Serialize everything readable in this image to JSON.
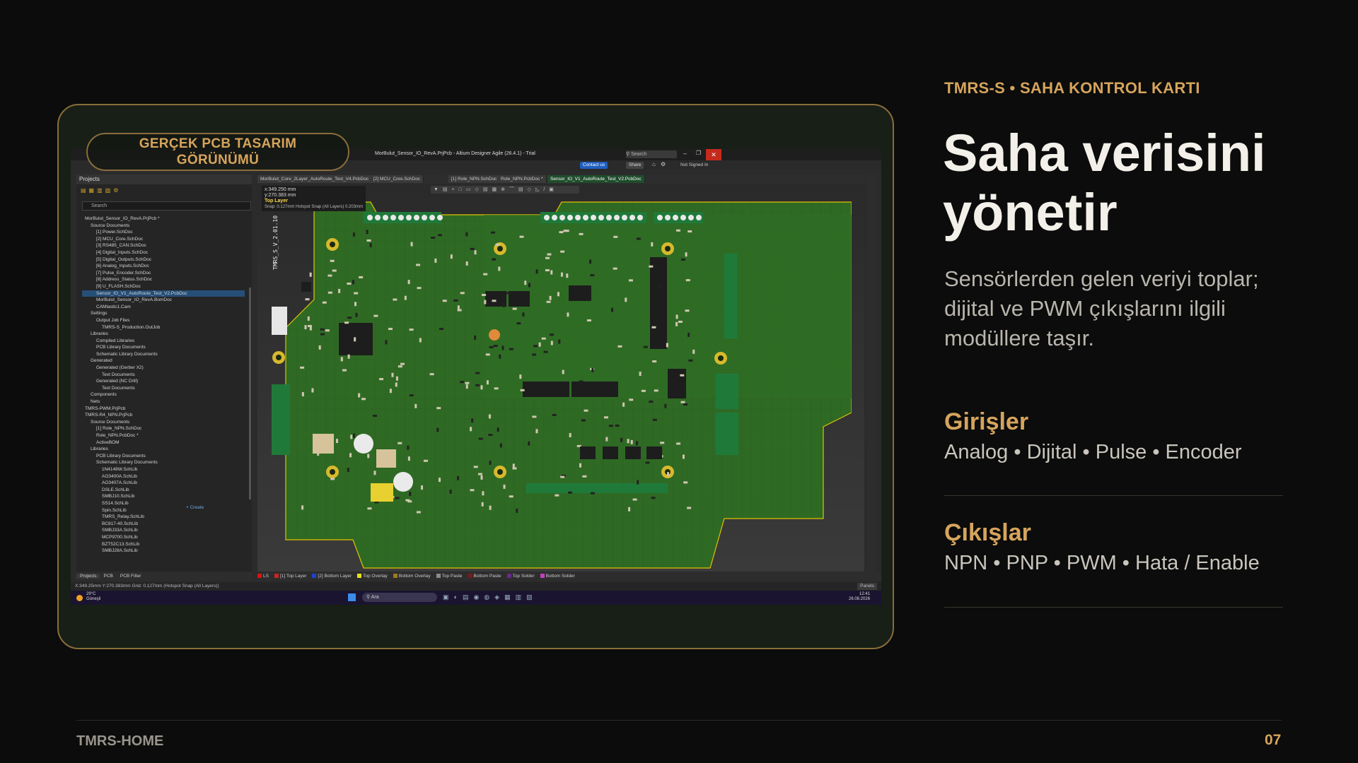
{
  "slide": {
    "eyebrow": "TMRS-S • SAHA KONTROL KARTI",
    "title_line1": "Saha verisini",
    "title_line2": "yönetir",
    "description": "Sensörlerden gelen veriyi toplar; dijital ve PWM çıkışlarını ilgili modüllere taşır.",
    "inputs": {
      "heading": "Girişler",
      "body": "Analog • Dijital • Pulse • Encoder"
    },
    "outputs": {
      "heading": "Çıkışlar",
      "body": "NPN • PNP • PWM • Hata / Enable"
    },
    "footer_left": "TMRS-HOME",
    "page_number": "07",
    "badge": "GERÇEK PCB TASARIM GÖRÜNÜMÜ"
  },
  "app": {
    "window_title": "MorBulut_Sensor_IO_RevA.PrjPcb - Altium Designer Agile (26.4.1) - Trial",
    "search_label": "Search",
    "contact_button": "Contact us",
    "share_button": "Share",
    "signin": "Not Signed In",
    "panel_title": "Projects",
    "panel_search": "Search",
    "tree": [
      "MorBulut_Sensor_IO_RevA.PrjPcb *",
      "Source Documents",
      "[1] Power.SchDoc",
      "[2] MCU_Core.SchDoc",
      "[3] RS485_CAN.SchDoc",
      "[4] Digital_Inputs.SchDoc",
      "[5] Digital_Outputs.SchDoc",
      "[6] Analog_Inputs.SchDoc",
      "[7] Pulse_Encoder.SchDoc",
      "[8] Address_Status.SchDoc",
      "[9] U_FLASH.SchDoc",
      "Sensor_IO_V1_AutoRoute_Test_V2.PcbDoc",
      "MorBulut_Sensor_IO_RevA.BomDoc",
      "CAMtastic1.Cam",
      "Settings",
      "Output Job Files",
      "TMRS-S_Production.OutJob",
      "Libraries",
      "Compiled Libraries",
      "PCB Library Documents",
      "Schematic Library Documents",
      "Generated",
      "Generated (Gerber X2)",
      "Text Documents",
      "Generated (NC Drill)",
      "Text Documents",
      "Components",
      "Nets",
      "TMRS-PWM.PrjPcb",
      "TMRS-R4_NPN.PrjPcb",
      "Source Documents",
      "[1] Role_NPN.SchDoc",
      "Role_NPN.PcbDoc *",
      "ActiveBOM",
      "Libraries",
      "PCB Library Documents",
      "Schematic Library Documents",
      "1N4148W.SchLib",
      "AO3400A.SchLib",
      "AO3407A.SchLib",
      "DSLE.SchLib",
      "SMBJ10.SchLib",
      "SS14.SchLib",
      "Spin.SchLib",
      "TMRS_Relay.SchLib",
      "BC817-40.SchLib",
      "SMBJ33A.SchLib",
      "MCP9700.SchLib",
      "BZT52C13.SchLib",
      "SMBJ28A.SchLib"
    ],
    "create_link": "+ Create",
    "tabs": [
      "MorBulut_Core_2Layer_AutoRoute_Test_V4.PcbDoc",
      "[2] MCU_Core.SchDoc",
      "[1] Role_NPN.SchDoc",
      "Role_NPN.PcbDoc *",
      "Sensor_IO_V1_AutoRoute_Test_V2.PcbDoc"
    ],
    "coord_x": "x:349.250  mm",
    "coord_y": "y:270.383  mm",
    "current_layer": "Top Layer",
    "snap_info": "Snap: 0.127mm Hotspot Snap (All Layers) 0.203mm",
    "board_label": "TMRS_S_V_2.01.10",
    "layers": [
      "LS",
      "[1] Top Layer",
      "[2] Bottom Layer",
      "Top Overlay",
      "Bottom Overlay",
      "Top Paste",
      "Bottom Paste",
      "Top Solder",
      "Bottom Solder"
    ],
    "layer_colors": [
      "#d11",
      "#c22",
      "#2040d0",
      "#e8e020",
      "#9b7b1b",
      "#8a8a8a",
      "#7a1a1a",
      "#6a2a8a",
      "#c040c0"
    ],
    "bottom_tabs": [
      "Projects",
      "PCB",
      "PCB Filter"
    ],
    "status_text": "X:349.25mm Y:270.383mm    Grid: 0.127mm    (Hotspot Snap (All Layers))",
    "panels_button": "Panels",
    "weather_temp": "29°C",
    "weather_desc": "Güneşli",
    "taskbar_search": "Ara",
    "clock_time": "12:41",
    "clock_date": "26.08.2026"
  }
}
